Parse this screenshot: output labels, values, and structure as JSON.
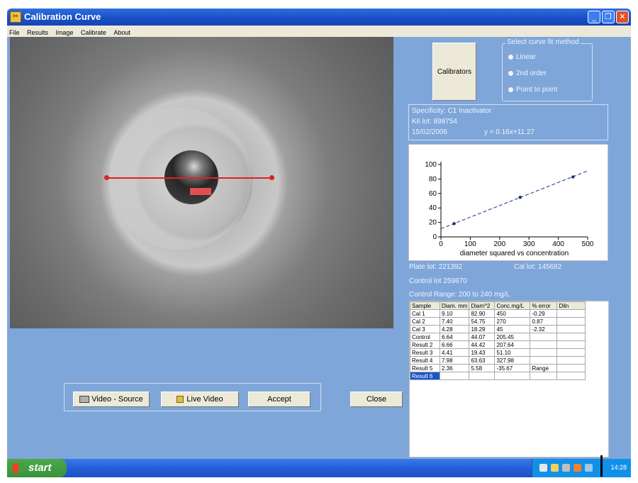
{
  "window": {
    "title": "Calibration Curve",
    "icon_text": "✂"
  },
  "menu": {
    "items": [
      "File",
      "Results",
      "Image",
      "Calibrate",
      "About"
    ]
  },
  "right_panel": {
    "calibrators_label": "Calibrators",
    "fit_method": {
      "legend": "Select curve fit method",
      "options": [
        "Linear",
        "2nd order",
        "Point to point"
      ]
    },
    "specificity": "Specificity:  C1 Inactivator",
    "kit_lot": "Kit lot:  898754",
    "date": "15/02/2006",
    "equation": "y =  0.16x+11.27",
    "plate_lot": "Plate lot: 221392",
    "cal_lot": "Cal lot:  145682",
    "control_lot": "Control lot 259870",
    "control_range": "Control Range:  200    to 240   mg/L"
  },
  "table": {
    "columns": [
      "Sample",
      "Diam. mm",
      "Diam^2",
      "Conc.mg/L",
      "% error",
      "Diln"
    ],
    "rows": [
      [
        "Cal 1",
        "9.10",
        "82.90",
        "450",
        "-0.29",
        ""
      ],
      [
        "Cal 2",
        "7.40",
        "54.75",
        "270",
        "0.87",
        ""
      ],
      [
        "Cal 3",
        "4.28",
        "18.29",
        "45",
        "-2.32",
        ""
      ],
      [
        "Control",
        "6.64",
        "44.07",
        "205.45",
        "",
        ""
      ],
      [
        "Result 2",
        "6.66",
        "44.42",
        "207.64",
        "",
        ""
      ],
      [
        "Result 3",
        "4.41",
        "19.43",
        "51.10",
        "",
        ""
      ],
      [
        "Result 4",
        "7.98",
        "63.63",
        "327.98",
        "",
        ""
      ],
      [
        "Result 5",
        "2.36",
        "5.58",
        "-35.67",
        "Range",
        ""
      ],
      [
        "Result 6",
        "",
        "",
        "",
        "",
        ""
      ]
    ],
    "selected_row": 8
  },
  "buttons": {
    "video_source": "Video - Source",
    "live_video": "Live Video",
    "accept": "Accept",
    "close": "Close"
  },
  "taskbar": {
    "start_label": "start",
    "clock": "14:28"
  },
  "chart_data": {
    "type": "line",
    "xlabel": "diameter squared vs concentration",
    "xlim": [
      0,
      500
    ],
    "ylim": [
      0,
      100
    ],
    "xticks": [
      0,
      100,
      200,
      300,
      400,
      500
    ],
    "yticks": [
      0,
      20,
      40,
      60,
      80,
      100
    ],
    "series": [
      {
        "style": "dashed",
        "x": [
          0,
          500
        ],
        "y": [
          11.27,
          91.27
        ]
      },
      {
        "style": "markers",
        "x": [
          45,
          270,
          450
        ],
        "y": [
          18.29,
          54.75,
          82.9
        ]
      }
    ]
  }
}
